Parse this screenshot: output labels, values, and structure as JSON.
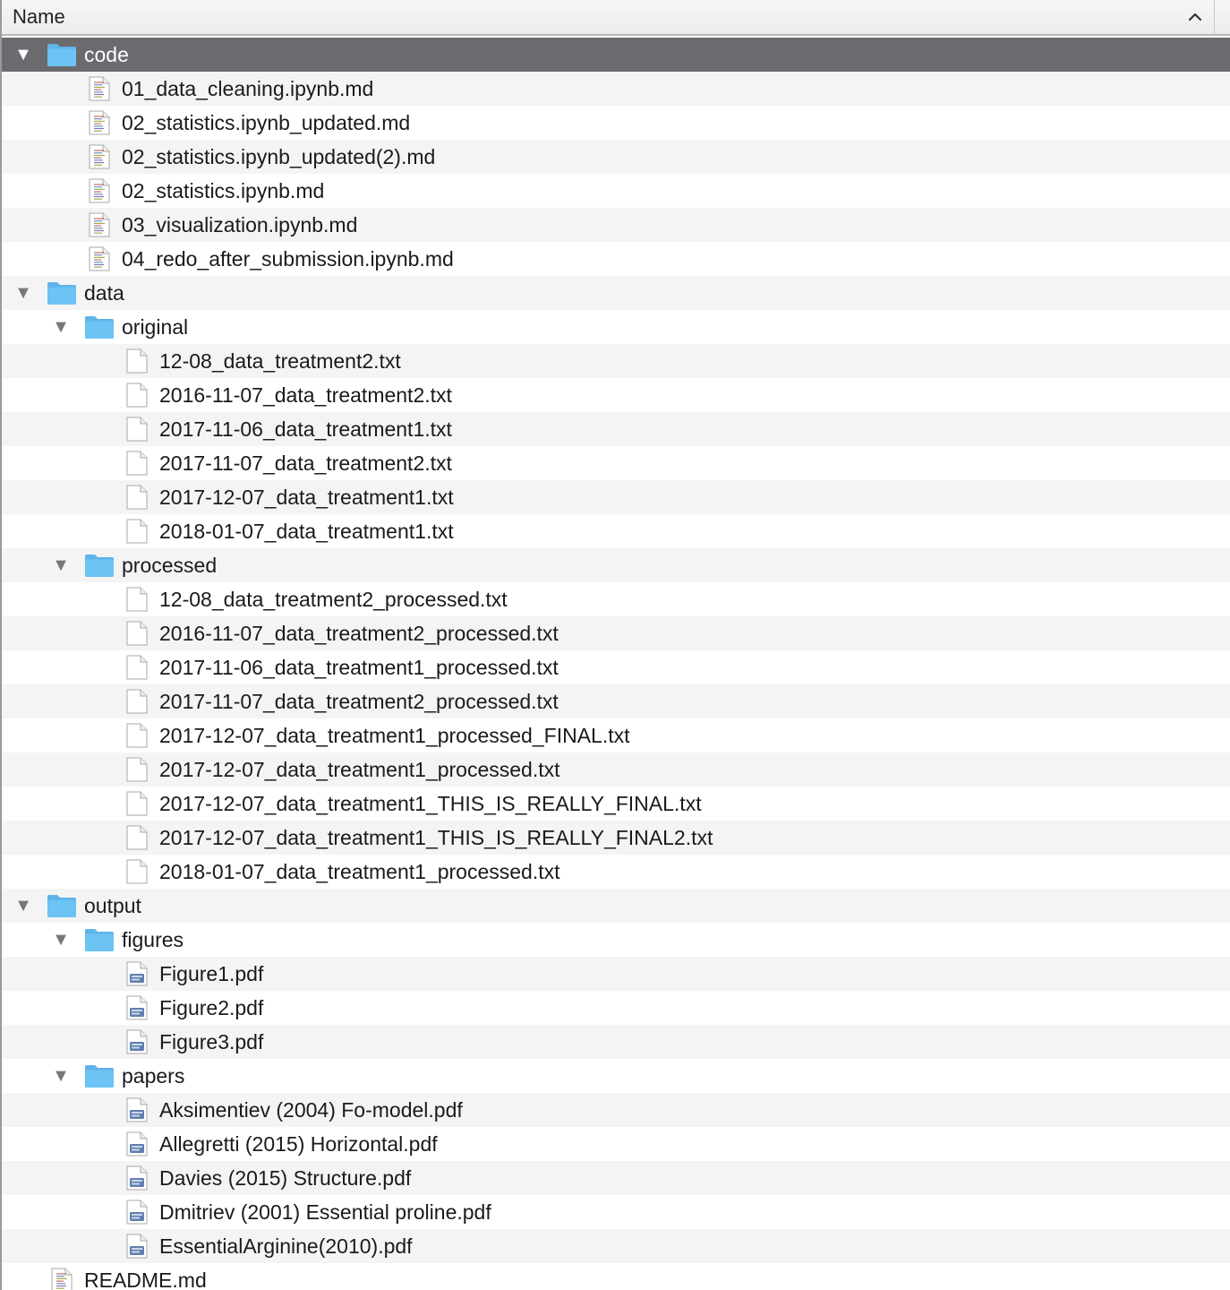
{
  "header": {
    "column_name": "Name",
    "sort": "ascending"
  },
  "colors": {
    "selected_row": "#6b6a6f",
    "alt_row": "#f4f4f4",
    "folder": "#6cc3f4"
  },
  "rows": [
    {
      "label": "code",
      "kind": "folder",
      "depth": 0,
      "expanded": true,
      "selected": true
    },
    {
      "label": "01_data_cleaning.ipynb.md",
      "kind": "md",
      "depth": 1
    },
    {
      "label": "02_statistics.ipynb_updated.md",
      "kind": "md",
      "depth": 1
    },
    {
      "label": "02_statistics.ipynb_updated(2).md",
      "kind": "md",
      "depth": 1
    },
    {
      "label": "02_statistics.ipynb.md",
      "kind": "md",
      "depth": 1
    },
    {
      "label": "03_visualization.ipynb.md",
      "kind": "md",
      "depth": 1
    },
    {
      "label": "04_redo_after_submission.ipynb.md",
      "kind": "md",
      "depth": 1
    },
    {
      "label": "data",
      "kind": "folder",
      "depth": 0,
      "expanded": true
    },
    {
      "label": "original",
      "kind": "folder",
      "depth": 1,
      "expanded": true
    },
    {
      "label": "12-08_data_treatment2.txt",
      "kind": "txt",
      "depth": 2
    },
    {
      "label": "2016-11-07_data_treatment2.txt",
      "kind": "txt",
      "depth": 2
    },
    {
      "label": "2017-11-06_data_treatment1.txt",
      "kind": "txt",
      "depth": 2
    },
    {
      "label": "2017-11-07_data_treatment2.txt",
      "kind": "txt",
      "depth": 2
    },
    {
      "label": "2017-12-07_data_treatment1.txt",
      "kind": "txt",
      "depth": 2
    },
    {
      "label": "2018-01-07_data_treatment1.txt",
      "kind": "txt",
      "depth": 2
    },
    {
      "label": "processed",
      "kind": "folder",
      "depth": 1,
      "expanded": true
    },
    {
      "label": "12-08_data_treatment2_processed.txt",
      "kind": "txt",
      "depth": 2
    },
    {
      "label": "2016-11-07_data_treatment2_processed.txt",
      "kind": "txt",
      "depth": 2
    },
    {
      "label": "2017-11-06_data_treatment1_processed.txt",
      "kind": "txt",
      "depth": 2
    },
    {
      "label": "2017-11-07_data_treatment2_processed.txt",
      "kind": "txt",
      "depth": 2
    },
    {
      "label": "2017-12-07_data_treatment1_processed_FINAL.txt",
      "kind": "txt",
      "depth": 2
    },
    {
      "label": "2017-12-07_data_treatment1_processed.txt",
      "kind": "txt",
      "depth": 2
    },
    {
      "label": "2017-12-07_data_treatment1_THIS_IS_REALLY_FINAL.txt",
      "kind": "txt",
      "depth": 2
    },
    {
      "label": "2017-12-07_data_treatment1_THIS_IS_REALLY_FINAL2.txt",
      "kind": "txt",
      "depth": 2
    },
    {
      "label": "2018-01-07_data_treatment1_processed.txt",
      "kind": "txt",
      "depth": 2
    },
    {
      "label": "output",
      "kind": "folder",
      "depth": 0,
      "expanded": true
    },
    {
      "label": "figures",
      "kind": "folder",
      "depth": 1,
      "expanded": true
    },
    {
      "label": "Figure1.pdf",
      "kind": "pdf",
      "depth": 2
    },
    {
      "label": "Figure2.pdf",
      "kind": "pdf",
      "depth": 2
    },
    {
      "label": "Figure3.pdf",
      "kind": "pdf",
      "depth": 2
    },
    {
      "label": "papers",
      "kind": "folder",
      "depth": 1,
      "expanded": true
    },
    {
      "label": "Aksimentiev (2004) Fo-model.pdf",
      "kind": "pdf",
      "depth": 2
    },
    {
      "label": "Allegretti (2015) Horizontal.pdf",
      "kind": "pdf",
      "depth": 2
    },
    {
      "label": "Davies (2015) Structure.pdf",
      "kind": "pdf",
      "depth": 2
    },
    {
      "label": "Dmitriev (2001) Essential proline.pdf",
      "kind": "pdf",
      "depth": 2
    },
    {
      "label": "EssentialArginine(2010).pdf",
      "kind": "pdf",
      "depth": 2
    },
    {
      "label": "README.md",
      "kind": "md",
      "depth": 0
    }
  ]
}
